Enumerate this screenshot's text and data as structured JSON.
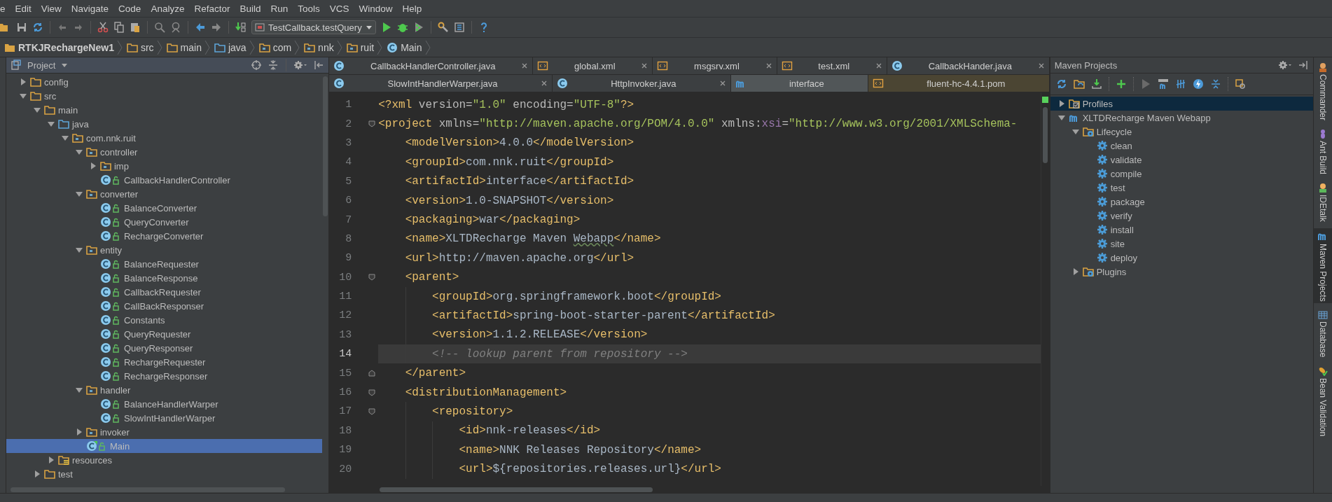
{
  "menu_bar": {
    "items": [
      "e",
      "Edit",
      "View",
      "Navigate",
      "Code",
      "Analyze",
      "Refactor",
      "Build",
      "Run",
      "Tools",
      "VCS",
      "Window",
      "Help"
    ]
  },
  "toolbar": {
    "run_config": "TestCallback.testQuery"
  },
  "breadcrumbs": [
    {
      "label": "RTKJRechargeNew1",
      "kind": "project"
    },
    {
      "label": "src",
      "kind": "folder"
    },
    {
      "label": "main",
      "kind": "folder"
    },
    {
      "label": "java",
      "kind": "source-folder"
    },
    {
      "label": "com",
      "kind": "package"
    },
    {
      "label": "nnk",
      "kind": "package"
    },
    {
      "label": "ruit",
      "kind": "package"
    },
    {
      "label": "Main",
      "kind": "class"
    }
  ],
  "project_panel": {
    "title": "Project",
    "tree": [
      {
        "label": "config",
        "kind": "folder",
        "expanded": false,
        "selected": false
      },
      {
        "label": "src",
        "kind": "folder",
        "expanded": true,
        "selected": false,
        "children": [
          {
            "label": "main",
            "kind": "folder",
            "expanded": true,
            "selected": false,
            "children": [
              {
                "label": "java",
                "kind": "source-folder",
                "expanded": true,
                "selected": false,
                "children": [
                  {
                    "label": "com.nnk.ruit",
                    "kind": "package",
                    "expanded": true,
                    "selected": false,
                    "children": [
                      {
                        "label": "controller",
                        "kind": "package",
                        "expanded": true,
                        "selected": false,
                        "children": [
                          {
                            "label": "imp",
                            "kind": "package",
                            "expanded": false,
                            "selected": false
                          },
                          {
                            "label": "CallbackHandlerController",
                            "kind": "class",
                            "selected": false
                          }
                        ]
                      },
                      {
                        "label": "converter",
                        "kind": "package",
                        "expanded": true,
                        "selected": false,
                        "children": [
                          {
                            "label": "BalanceConverter",
                            "kind": "class",
                            "selected": false
                          },
                          {
                            "label": "QueryConverter",
                            "kind": "class",
                            "selected": false
                          },
                          {
                            "label": "RechargeConverter",
                            "kind": "class",
                            "selected": false
                          }
                        ]
                      },
                      {
                        "label": "entity",
                        "kind": "package",
                        "expanded": true,
                        "selected": false,
                        "children": [
                          {
                            "label": "BalanceRequester",
                            "kind": "class",
                            "selected": false
                          },
                          {
                            "label": "BalanceResponse",
                            "kind": "class",
                            "selected": false
                          },
                          {
                            "label": "CallbackRequester",
                            "kind": "class",
                            "selected": false
                          },
                          {
                            "label": "CallBackResponser",
                            "kind": "class",
                            "selected": false
                          },
                          {
                            "label": "Constants",
                            "kind": "class",
                            "selected": false
                          },
                          {
                            "label": "QueryRequester",
                            "kind": "class",
                            "selected": false
                          },
                          {
                            "label": "QueryResponser",
                            "kind": "class",
                            "selected": false
                          },
                          {
                            "label": "RechargeRequester",
                            "kind": "class",
                            "selected": false
                          },
                          {
                            "label": "RechargeResponser",
                            "kind": "class",
                            "selected": false
                          }
                        ]
                      },
                      {
                        "label": "handler",
                        "kind": "package",
                        "expanded": true,
                        "selected": false,
                        "children": [
                          {
                            "label": "BalanceHandlerWarper",
                            "kind": "class",
                            "selected": false
                          },
                          {
                            "label": "SlowIntHandlerWarper",
                            "kind": "class",
                            "selected": false
                          }
                        ]
                      },
                      {
                        "label": "invoker",
                        "kind": "package",
                        "expanded": false,
                        "selected": false
                      },
                      {
                        "label": "Main",
                        "kind": "main-class",
                        "selected": true
                      }
                    ]
                  }
                ]
              },
              {
                "label": "resources",
                "kind": "resources",
                "expanded": false,
                "selected": false
              }
            ]
          },
          {
            "label": "test",
            "kind": "folder",
            "expanded": false,
            "selected": false
          }
        ]
      }
    ]
  },
  "editor": {
    "tab_rows": [
      [
        {
          "label": "CallbackHandlerController.java",
          "kind": "java",
          "selected": false,
          "closable": true,
          "library": false
        },
        {
          "label": "global.xml",
          "kind": "xml",
          "selected": false,
          "closable": true,
          "library": false
        },
        {
          "label": "msgsrv.xml",
          "kind": "xml",
          "selected": false,
          "closable": true,
          "library": false
        },
        {
          "label": "test.xml",
          "kind": "xml",
          "selected": false,
          "closable": true,
          "library": false
        },
        {
          "label": "CallbackHander.java",
          "kind": "java",
          "selected": false,
          "closable": true,
          "library": false
        }
      ],
      [
        {
          "label": "SlowIntHandlerWarper.java",
          "kind": "java",
          "selected": false,
          "closable": true,
          "library": false
        },
        {
          "label": "HttpInvoker.java",
          "kind": "java",
          "selected": false,
          "closable": true,
          "library": false
        },
        {
          "label": "interface",
          "kind": "maven",
          "selected": true,
          "closable": false,
          "library": false
        },
        {
          "label": "fluent-hc-4.4.1.pom",
          "kind": "xml",
          "selected": false,
          "closable": false,
          "library": true
        }
      ]
    ],
    "lines": [
      {
        "number": "1",
        "kind": "plain",
        "current": false,
        "tokens": [
          {
            "kind": "tag",
            "text": "<?xml"
          },
          {
            "kind": "attr",
            "text": " version="
          },
          {
            "kind": "value",
            "text": "\"1.0\""
          },
          {
            "kind": "attr",
            "text": " encoding="
          },
          {
            "kind": "value",
            "text": "\"UTF-8\""
          },
          {
            "kind": "tag",
            "text": "?>"
          }
        ]
      },
      {
        "number": "2",
        "kind": "fold-start",
        "current": false,
        "tokens": [
          {
            "kind": "tag",
            "text": "<project"
          },
          {
            "kind": "attr",
            "text": " xmlns="
          },
          {
            "kind": "value",
            "text": "\"http://maven.apache.org/POM/4.0.0\""
          },
          {
            "kind": "attr",
            "text": " xmlns:"
          },
          {
            "kind": "ns",
            "text": "xsi"
          },
          {
            "kind": "attr",
            "text": "="
          },
          {
            "kind": "value",
            "text": "\"http://www.w3.org/2001/XMLSchema-"
          }
        ],
        "children": [
          {
            "number": "3",
            "kind": "plain",
            "current": false,
            "tokens": [
              {
                "kind": "tag",
                "text": "<modelVersion>"
              },
              {
                "kind": "text",
                "text": "4.0.0"
              },
              {
                "kind": "tag",
                "text": "</modelVersion>"
              }
            ]
          },
          {
            "number": "4",
            "kind": "plain",
            "current": false,
            "tokens": [
              {
                "kind": "tag",
                "text": "<groupId>"
              },
              {
                "kind": "text",
                "text": "com.nnk.ruit"
              },
              {
                "kind": "tag",
                "text": "</groupId>"
              }
            ]
          },
          {
            "number": "5",
            "kind": "plain",
            "current": false,
            "tokens": [
              {
                "kind": "tag",
                "text": "<artifactId>"
              },
              {
                "kind": "text",
                "text": "interface"
              },
              {
                "kind": "tag",
                "text": "</artifactId>"
              }
            ]
          },
          {
            "number": "6",
            "kind": "plain",
            "current": false,
            "tokens": [
              {
                "kind": "tag",
                "text": "<version>"
              },
              {
                "kind": "text",
                "text": "1.0-SNAPSHOT"
              },
              {
                "kind": "tag",
                "text": "</version>"
              }
            ]
          },
          {
            "number": "7",
            "kind": "plain",
            "current": false,
            "tokens": [
              {
                "kind": "tag",
                "text": "<packaging>"
              },
              {
                "kind": "text",
                "text": "war"
              },
              {
                "kind": "tag",
                "text": "</packaging>"
              }
            ]
          },
          {
            "number": "8",
            "kind": "plain",
            "current": false,
            "tokens": [
              {
                "kind": "tag",
                "text": "<name>"
              },
              {
                "kind": "text",
                "text": "XLTDRecharge Maven "
              },
              {
                "kind": "typo",
                "text": "Webapp"
              },
              {
                "kind": "tag",
                "text": "</name>"
              }
            ]
          },
          {
            "number": "9",
            "kind": "plain",
            "current": false,
            "tokens": [
              {
                "kind": "tag",
                "text": "<url>"
              },
              {
                "kind": "text",
                "text": "http://maven.apache.org"
              },
              {
                "kind": "tag",
                "text": "</url>"
              }
            ]
          },
          {
            "number": "10",
            "kind": "fold-start",
            "current": false,
            "tokens": [
              {
                "kind": "tag",
                "text": "<parent>"
              }
            ],
            "children": [
              {
                "number": "11",
                "kind": "plain",
                "current": false,
                "tokens": [
                  {
                    "kind": "tag",
                    "text": "<groupId>"
                  },
                  {
                    "kind": "text",
                    "text": "org.springframework.boot"
                  },
                  {
                    "kind": "tag",
                    "text": "</groupId>"
                  }
                ]
              },
              {
                "number": "12",
                "kind": "plain",
                "current": false,
                "tokens": [
                  {
                    "kind": "tag",
                    "text": "<artifactId>"
                  },
                  {
                    "kind": "text",
                    "text": "spring-boot-starter-parent"
                  },
                  {
                    "kind": "tag",
                    "text": "</artifactId>"
                  }
                ]
              },
              {
                "number": "13",
                "kind": "plain",
                "current": false,
                "tokens": [
                  {
                    "kind": "tag",
                    "text": "<version>"
                  },
                  {
                    "kind": "text",
                    "text": "1.1.2.RELEASE"
                  },
                  {
                    "kind": "tag",
                    "text": "</version>"
                  }
                ]
              },
              {
                "number": "14",
                "kind": "plain",
                "current": true,
                "tokens": [
                  {
                    "kind": "comment",
                    "text": "<!-- lookup parent from repository -->"
                  }
                ]
              }
            ]
          },
          {
            "number": "15",
            "kind": "fold-end",
            "current": false,
            "tokens": [
              {
                "kind": "tag",
                "text": "</parent>"
              }
            ]
          },
          {
            "number": "16",
            "kind": "fold-start",
            "current": false,
            "tokens": [
              {
                "kind": "tag",
                "text": "<distributionManagement>"
              }
            ],
            "children": [
              {
                "number": "17",
                "kind": "fold-start",
                "current": false,
                "tokens": [
                  {
                    "kind": "tag",
                    "text": "<repository>"
                  }
                ],
                "children": [
                  {
                    "number": "18",
                    "current": false,
                    "tokens": [
                      {
                        "kind": "tag",
                        "text": "<id>"
                      },
                      {
                        "kind": "text",
                        "text": "nnk-releases"
                      },
                      {
                        "kind": "tag",
                        "text": "</id>"
                      }
                    ]
                  },
                  {
                    "number": "19",
                    "current": false,
                    "tokens": [
                      {
                        "kind": "tag",
                        "text": "<name>"
                      },
                      {
                        "kind": "text",
                        "text": "NNK Releases Repository"
                      },
                      {
                        "kind": "tag",
                        "text": "</name>"
                      }
                    ]
                  },
                  {
                    "number": "20",
                    "current": false,
                    "tokens": [
                      {
                        "kind": "tag",
                        "text": "<url>"
                      },
                      {
                        "kind": "text",
                        "text": "${repositories.releases.url}"
                      },
                      {
                        "kind": "tag",
                        "text": "</url>"
                      }
                    ]
                  }
                ]
              }
            ]
          }
        ]
      }
    ]
  },
  "maven_panel": {
    "title": "Maven Projects",
    "tree": [
      {
        "label": "Profiles",
        "kind": "profiles",
        "expanded": false,
        "selected": true
      },
      {
        "label": "XLTDRecharge Maven Webapp",
        "kind": "project",
        "expanded": true,
        "selected": false,
        "children": [
          {
            "label": "Lifecycle",
            "kind": "lifecycle",
            "expanded": true,
            "selected": false,
            "children": [
              {
                "label": "clean",
                "kind": "goal",
                "selected": false
              },
              {
                "label": "validate",
                "kind": "goal",
                "selected": false
              },
              {
                "label": "compile",
                "kind": "goal",
                "selected": false
              },
              {
                "label": "test",
                "kind": "goal",
                "selected": false
              },
              {
                "label": "package",
                "kind": "goal",
                "selected": false
              },
              {
                "label": "verify",
                "kind": "goal",
                "selected": false
              },
              {
                "label": "install",
                "kind": "goal",
                "selected": false
              },
              {
                "label": "site",
                "kind": "goal",
                "selected": false
              },
              {
                "label": "deploy",
                "kind": "goal",
                "selected": false
              }
            ]
          },
          {
            "label": "Plugins",
            "kind": "lifecycle",
            "expanded": false,
            "selected": false
          }
        ]
      }
    ]
  },
  "side_tabs": [
    {
      "label": "Commander",
      "kind": "commander",
      "selected": false
    },
    {
      "label": "Ant Build",
      "kind": "ant",
      "selected": false
    },
    {
      "label": "IDEtalk",
      "kind": "talk",
      "selected": false
    },
    {
      "label": "Maven Projects",
      "kind": "maven",
      "selected": true
    },
    {
      "label": "Database",
      "kind": "database",
      "selected": false
    },
    {
      "label": "Bean Validation",
      "kind": "bean",
      "selected": false
    }
  ]
}
